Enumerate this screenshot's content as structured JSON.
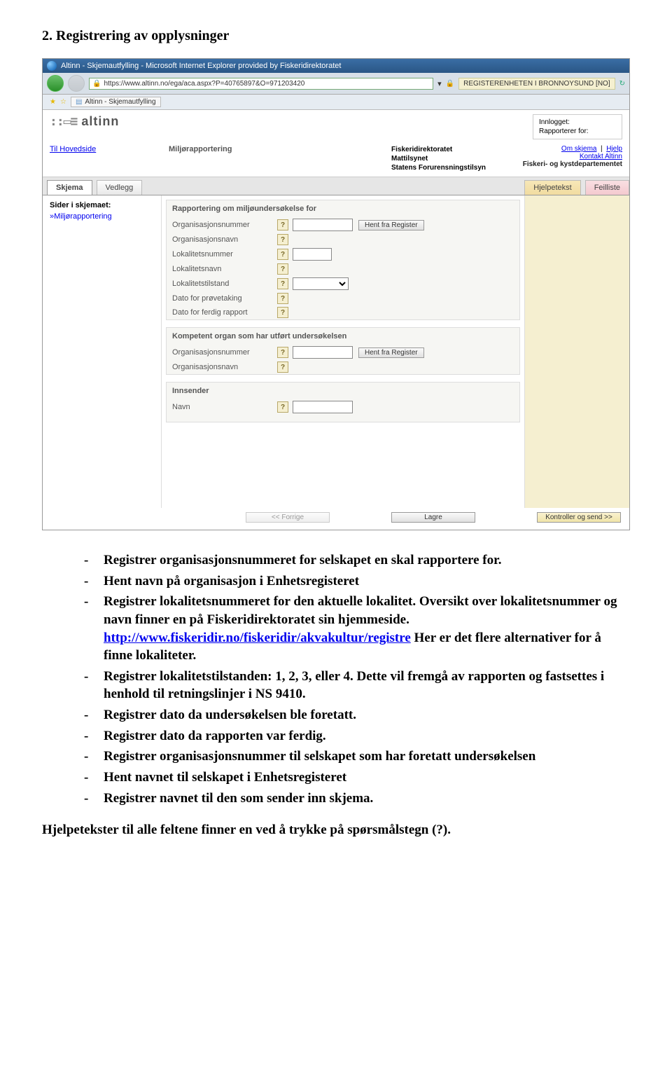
{
  "doc": {
    "section_title": "2.  Registrering av opplysninger",
    "help_note": "Hjelpetekster til alle feltene finner en ved å trykke på spørsmålstegn (?)."
  },
  "bullets": [
    "Registrer organisasjonsnummeret for selskapet en skal rapportere for.",
    "Hent navn på organisasjon i Enhetsregisteret",
    "Registrer lokalitetsnummeret for den aktuelle lokalitet. Oversikt over lokalitetsnummer og navn finner en på Fiskeridirektoratet sin hjemmeside. __LINK__ Her er det flere alternativer for å finne lokaliteter.",
    "Registrer lokalitetstilstanden: 1, 2, 3, eller 4. Dette vil fremgå av rapporten og fastsettes i henhold til retningslinjer i NS 9410.",
    "Registrer dato da undersøkelsen ble foretatt.",
    "Registrer dato da rapporten var ferdig.",
    "Registrer organisasjonsnummer til selskapet som har foretatt undersøkelsen",
    "Hent navnet til selskapet i Enhetsregisteret",
    "Registrer navnet til den som sender inn skjema."
  ],
  "link_text": "http://www.fiskeridir.no/fiskeridir/akvakultur/registre",
  "browser": {
    "window_title": "Altinn - Skjemautfylling - Microsoft Internet Explorer provided by Fiskeridirektoratet",
    "url": "https://www.altinn.no/ega/aca.aspx?P=40765897&O=971203420",
    "security_zone": "REGISTERENHETEN I BRONNOYSUND [NO]",
    "fav_tab": "Altinn - Skjemautfylling"
  },
  "altinn": {
    "logo": "altinn",
    "hoved": "Til Hovedside",
    "logged_label1": "Innlogget:",
    "logged_label2": "Rapporterer for:",
    "report_title": "Miljørapportering",
    "agencies": "Fiskeridirektoratet\nMattilsynet\nStatens Forurensningstilsyn",
    "links": {
      "om": "Om skjema",
      "hjelp": "Hjelp",
      "kontakt": "Kontakt Altinn",
      "dept": "Fiskeri- og kystdepartementet"
    },
    "tabs": {
      "skjema": "Skjema",
      "vedlegg": "Vedlegg",
      "hjelpe": "Hjelpetekst",
      "feil": "Feilliste"
    },
    "side": {
      "title": "Sider i skjemaet:",
      "item": "Miljørapportering"
    },
    "form": {
      "sec1": "Rapportering om miljøundersøkelse for",
      "orgnr": "Organisasjonsnummer",
      "hent_reg": "Hent fra Register",
      "orgnavn": "Organisasjonsnavn",
      "loknr": "Lokalitetsnummer",
      "loknavn": "Lokalitetsnavn",
      "loktilstand": "Lokalitetstilstand",
      "dato_prove": "Dato for prøvetaking",
      "dato_rapport": "Dato for ferdig rapport",
      "sec2": "Kompetent organ som har utført undersøkelsen",
      "sec3": "Innsender",
      "navn": "Navn"
    },
    "actions": {
      "forrige": "<< Forrige",
      "lagre": "Lagre",
      "kontroller": "Kontroller og send >>"
    }
  }
}
